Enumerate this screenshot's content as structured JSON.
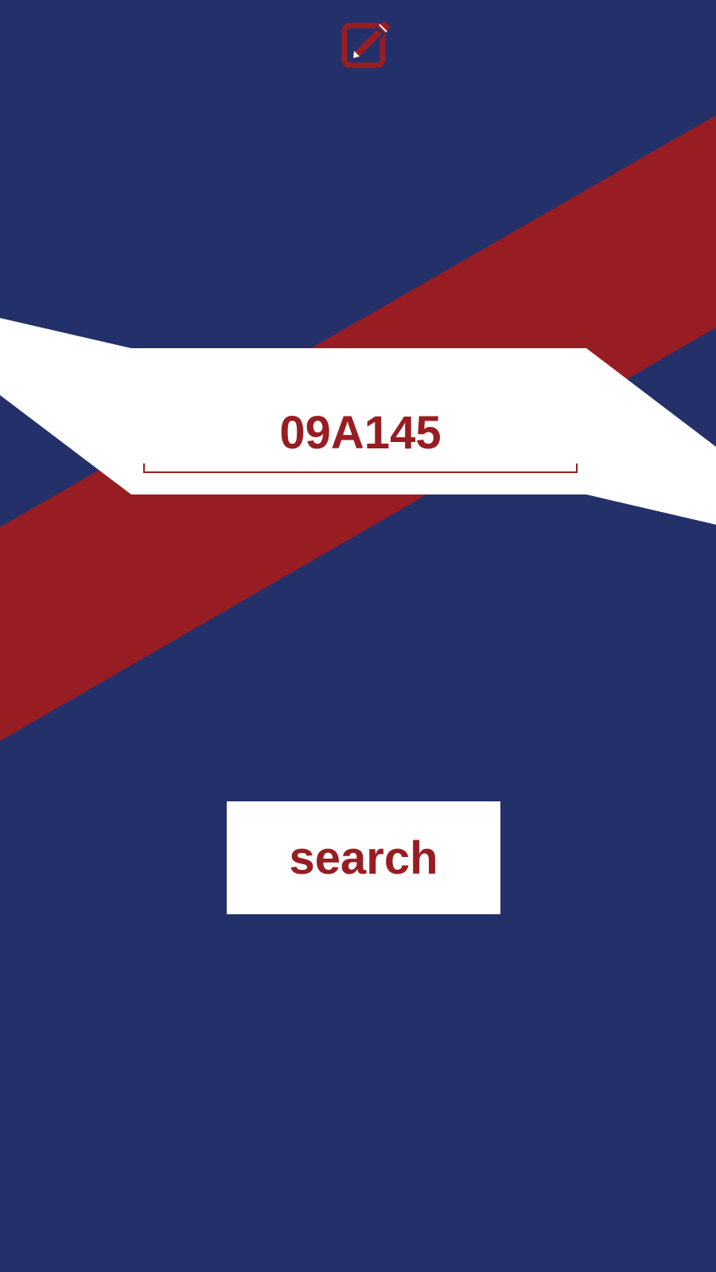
{
  "colors": {
    "background": "#24306a",
    "accent": "#981d22",
    "surface": "#ffffff"
  },
  "header": {
    "icon": "edit-icon"
  },
  "code_field": {
    "value": "09A145"
  },
  "search": {
    "label": "search"
  }
}
